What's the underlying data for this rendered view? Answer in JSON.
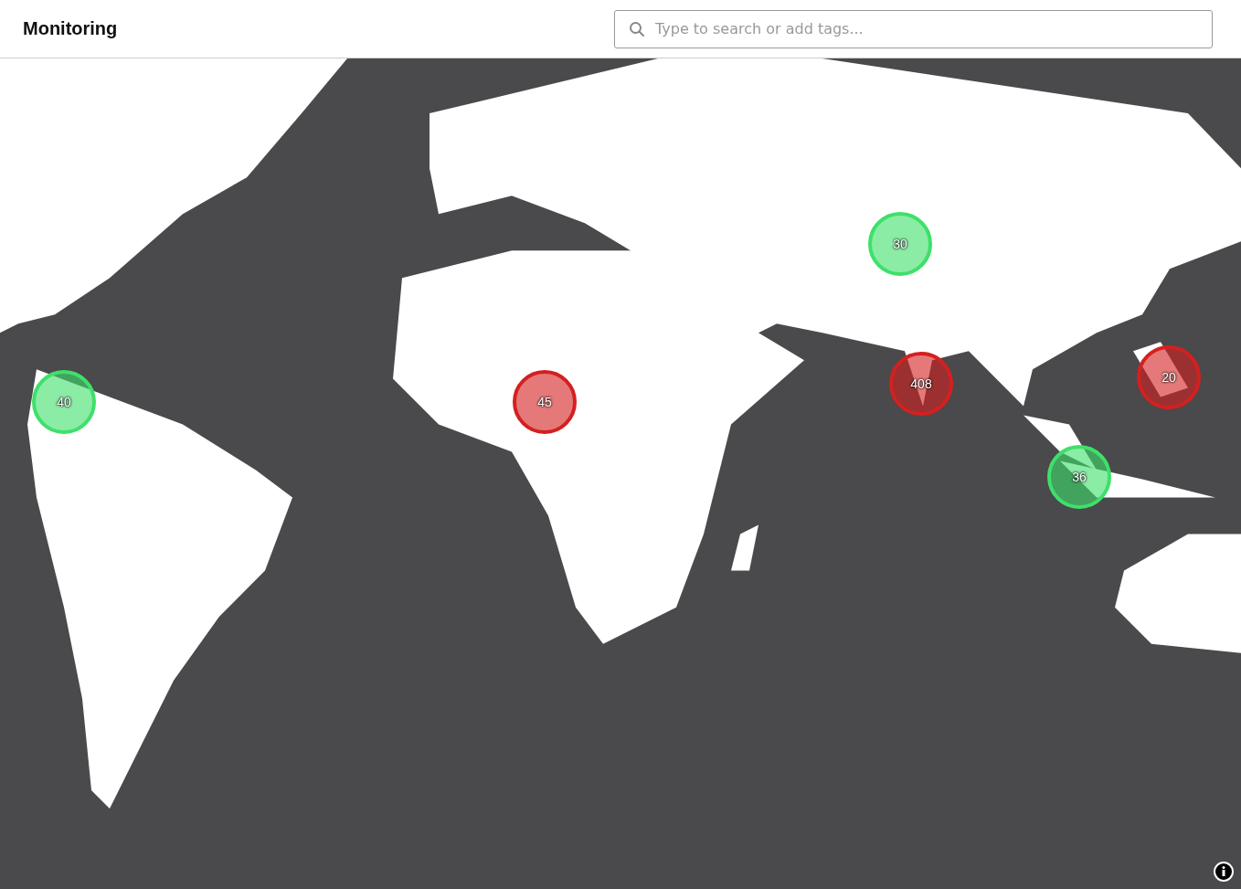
{
  "header": {
    "title": "Monitoring",
    "search": {
      "placeholder": "Type to search or add tags..."
    }
  },
  "map": {
    "kind": "picture",
    "clusters": [
      {
        "count": "40",
        "color": "#3ee06a"
      },
      {
        "count": "45",
        "color": "#d42020"
      },
      {
        "count": "30",
        "color": "#3ee06a"
      },
      {
        "count": "408",
        "color": "#d42020"
      },
      {
        "count": "20",
        "color": "#d42020"
      },
      {
        "count": "36",
        "color": "#3ee06a"
      }
    ]
  }
}
